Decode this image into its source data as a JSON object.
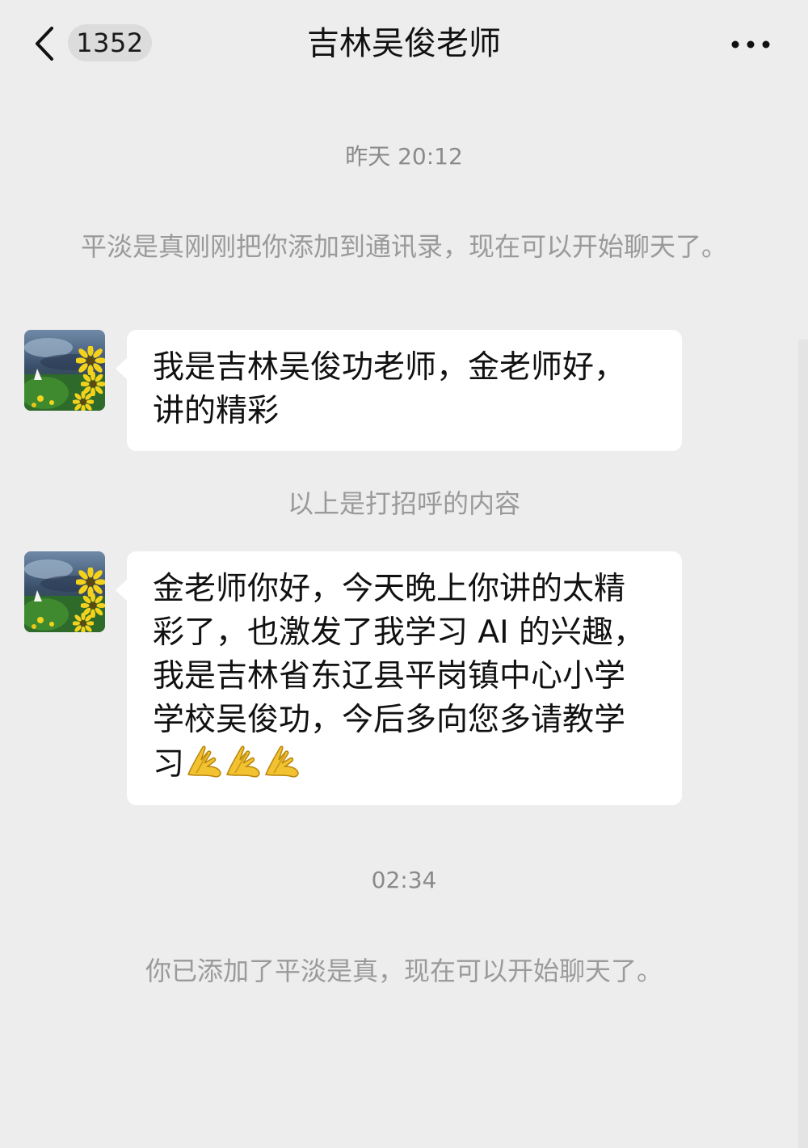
{
  "nav": {
    "back_icon": "chevron-left-icon",
    "unread_count": "1352",
    "title": "吉林吴俊老师",
    "more_icon": "more-dots-icon"
  },
  "messages": [
    {
      "type": "time",
      "text": "昨天 20:12"
    },
    {
      "type": "system",
      "text": "平淡是真刚刚把你添加到通讯录，现在可以开始聊天了。"
    },
    {
      "type": "incoming",
      "text": "我是吉林吴俊功老师，金老师好，讲的精彩"
    },
    {
      "type": "system",
      "text": "以上是打招呼的内容"
    },
    {
      "type": "incoming",
      "text": "金老师你好，今天晚上你讲的太精彩了，也激发了我学习 AI 的兴趣，我是吉林省东辽县平岗镇中心小学学校吴俊功，今后多向您多请教学习",
      "emoji": [
        "folded-hands-emoji",
        "folded-hands-emoji",
        "folded-hands-emoji"
      ]
    },
    {
      "type": "time",
      "text": "02:34"
    },
    {
      "type": "system",
      "text": "你已添加了平淡是真，现在可以开始聊天了。"
    }
  ],
  "colors": {
    "background": "#ededed",
    "bubble": "#ffffff",
    "system_text": "#9a9a9a"
  }
}
